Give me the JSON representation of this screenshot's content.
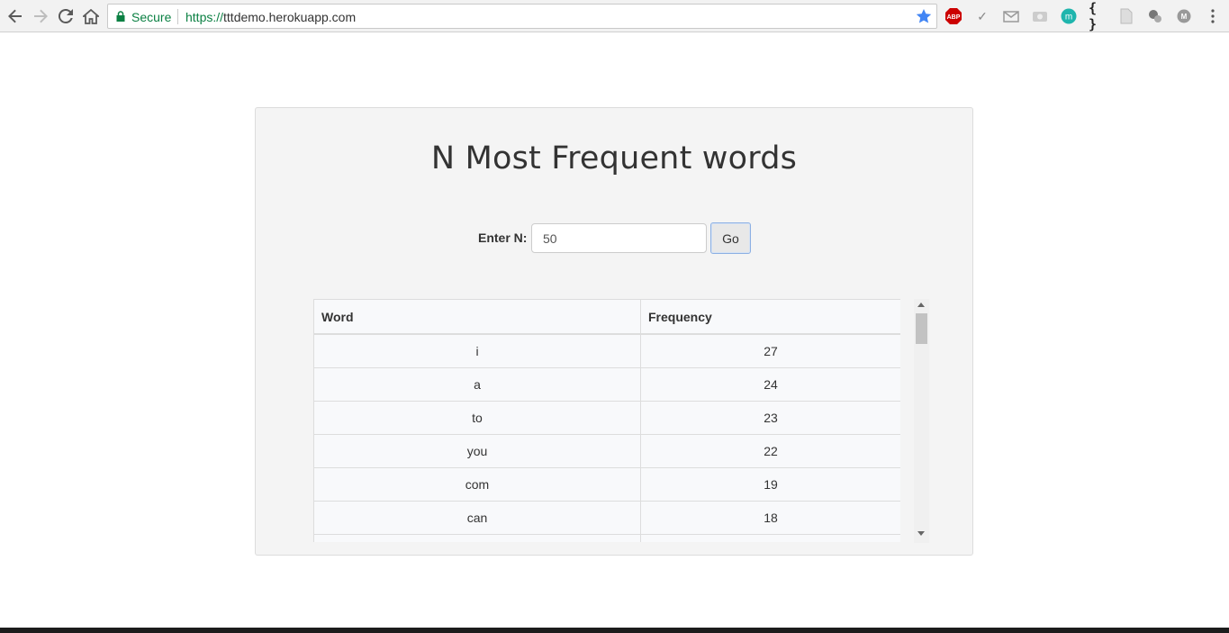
{
  "browser": {
    "secure_label": "Secure",
    "url_scheme": "https://",
    "url_host": "tttdemo.herokuapp.com",
    "accent_color": "#0b8043",
    "extensions": [
      "abp-icon",
      "check-icon",
      "mail-icon",
      "camera-icon",
      "m-extension-icon",
      "json-icon",
      "pdf-icon",
      "puzzle-icon",
      "profile-icon",
      "menu-icon"
    ],
    "abp_label": "ABP",
    "m_label": "m",
    "braces_label": "{ }",
    "profile_label": "M"
  },
  "page": {
    "title": "N Most Frequent words",
    "form": {
      "label": "Enter N:",
      "value": "50",
      "button_label": "Go"
    },
    "table": {
      "headers": [
        "Word",
        "Frequency"
      ],
      "rows": [
        {
          "word": "i",
          "frequency": "27"
        },
        {
          "word": "a",
          "frequency": "24"
        },
        {
          "word": "to",
          "frequency": "23"
        },
        {
          "word": "you",
          "frequency": "22"
        },
        {
          "word": "com",
          "frequency": "19"
        },
        {
          "word": "can",
          "frequency": "18"
        }
      ]
    }
  }
}
